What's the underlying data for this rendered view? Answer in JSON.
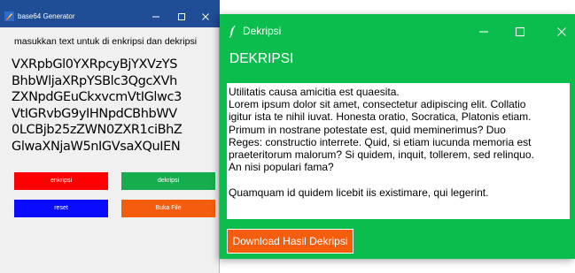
{
  "generator_window": {
    "title": "base64 Generator",
    "controls": {
      "minimize_icon": "minimize-icon",
      "maximize_icon": "maximize-icon",
      "close_icon": "close-icon"
    },
    "instruction": "masukkan text untuk di enkripsi dan dekripsi",
    "input_value": "VXRpbGl0YXRpcyBjYXVzYS\nBhbWljaXRpYSBlc3QgcXVh\nZXNpdGEuCkxvcmVtIGlwc3\nVtIGRvbG9yIHNpdCBhbWV\n0LCBjb25zZWN0ZXR1ciBhZ\nGlwaXNjaW5nIGVsaXQuIEN",
    "buttons": {
      "enkripsi": "enkripsi",
      "dekripsi": "dekripsi",
      "reset": "reset",
      "buka_file": "Buka File"
    },
    "colors": {
      "enkripsi": "#ff0000",
      "dekripsi": "#16ad4f",
      "reset": "#0a0aff",
      "buka_file": "#f45d0e",
      "titlebar": "#1f4e96"
    }
  },
  "dekripsi_window": {
    "title": "Dekripsi",
    "controls": {
      "minimize_icon": "minimize-icon",
      "maximize_icon": "maximize-icon",
      "close_icon": "close-icon"
    },
    "heading": "DEKRIPSI",
    "text_lines": [
      "Utilitatis causa amicitia est quaesita.",
      "Lorem ipsum dolor sit amet, consectetur adipiscing elit. Collatio",
      "igitur ista te nihil iuvat. Honesta oratio, Socratica, Platonis etiam.",
      "Primum in nostrane potestate est, quid meminerimus? Duo",
      "Reges: constructio interrete. Quid, si etiam iucunda memoria est",
      "praeteritorum malorum? Si quidem, inquit, tollerem, sed relinquo.",
      "An nisi populari fama?",
      "",
      "Quamquam id quidem licebit iis existimare, qui legerint."
    ],
    "download_button": "Download Hasil Dekripsi",
    "colors": {
      "background": "#0bbd4c",
      "download_button": "#f45d0e"
    }
  }
}
